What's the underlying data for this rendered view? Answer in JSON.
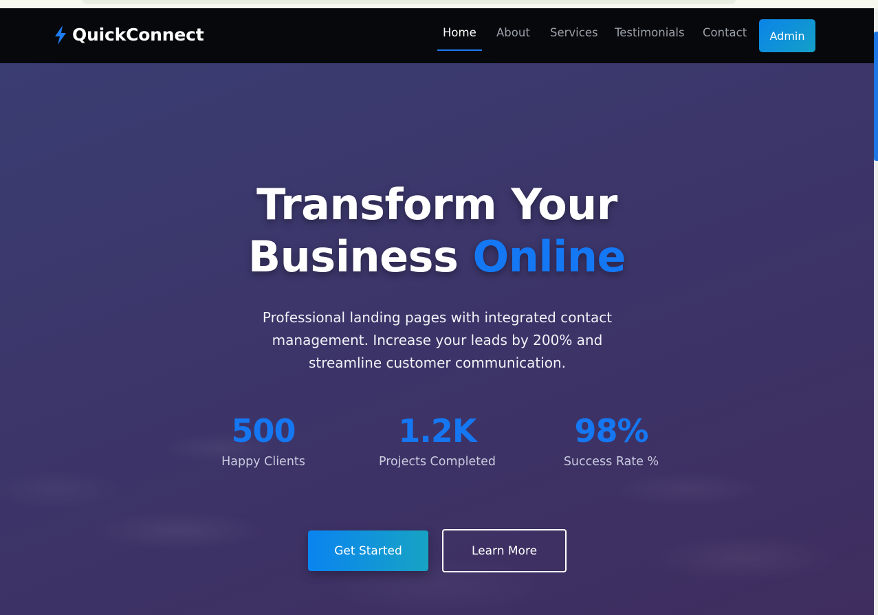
{
  "brand": {
    "name": "QuickConnect",
    "icon": "lightning-bolt-icon",
    "icon_color": "#1e7cf0"
  },
  "nav": {
    "items": [
      {
        "label": "Home",
        "active": true
      },
      {
        "label": "About",
        "active": false
      },
      {
        "label": "Services",
        "active": false
      },
      {
        "label": "Testimonials",
        "active": false
      },
      {
        "label": "Contact",
        "active": false
      }
    ],
    "admin_label": "Admin"
  },
  "hero": {
    "title_line1": "Transform Your",
    "title_line2_prefix": "Business",
    "title_line2_accent": "Online",
    "subtitle": "Professional landing pages with integrated contact management. Increase your leads by 200% and streamline customer communication.",
    "stats": [
      {
        "value": "500",
        "label": "Happy Clients"
      },
      {
        "value": "1.2K",
        "label": "Projects Completed"
      },
      {
        "value": "98%",
        "label": "Success Rate %"
      }
    ],
    "primary_cta": "Get Started",
    "secondary_cta": "Learn More"
  },
  "colors": {
    "accent": "#1478f5",
    "navbar_bg": "#07080c",
    "hero_bg_start": "#3a3d72",
    "hero_bg_end": "#3f2d5f"
  }
}
